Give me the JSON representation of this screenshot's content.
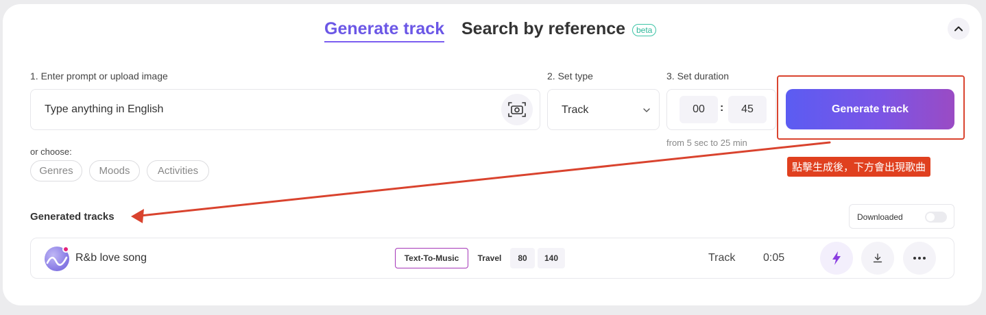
{
  "tabs": {
    "generate": "Generate track",
    "search": "Search by reference",
    "search_badge": "beta"
  },
  "prompt": {
    "label": "1. Enter prompt or upload image",
    "placeholder": "Type anything in English"
  },
  "type": {
    "label": "2. Set type",
    "value": "Track"
  },
  "duration": {
    "label": "3. Set duration",
    "minutes": "00",
    "seconds": "45",
    "separator": ":",
    "hint": "from 5 sec to 25 min"
  },
  "generate_button": "Generate track",
  "annotation": "點擊生成後，下方會出現歌曲",
  "choose": {
    "label": "or choose:",
    "chips": [
      "Genres",
      "Moods",
      "Activities"
    ]
  },
  "generated": {
    "title": "Generated tracks",
    "downloaded_label": "Downloaded",
    "downloaded_on": false,
    "tracks": [
      {
        "name": "R&b love song",
        "tags": [
          "Text-To-Music",
          "Travel",
          "80",
          "140"
        ],
        "type": "Track",
        "duration": "0:05"
      }
    ]
  },
  "colors": {
    "accent": "#6b57e6",
    "button_gradient_start": "#5b5cf2",
    "button_gradient_end": "#9a4bc4",
    "annotation_red": "#e0401f",
    "beta_green": "#2eb89a",
    "tag_border": "#a435b8",
    "bolt_purple": "#8a3ee0"
  },
  "icons": {
    "collapse": "chevron-up-icon",
    "camera": "camera-icon",
    "type_dropdown": "chevron-down-icon",
    "remix": "lightning-icon",
    "download": "download-icon",
    "more": "more-icon"
  }
}
